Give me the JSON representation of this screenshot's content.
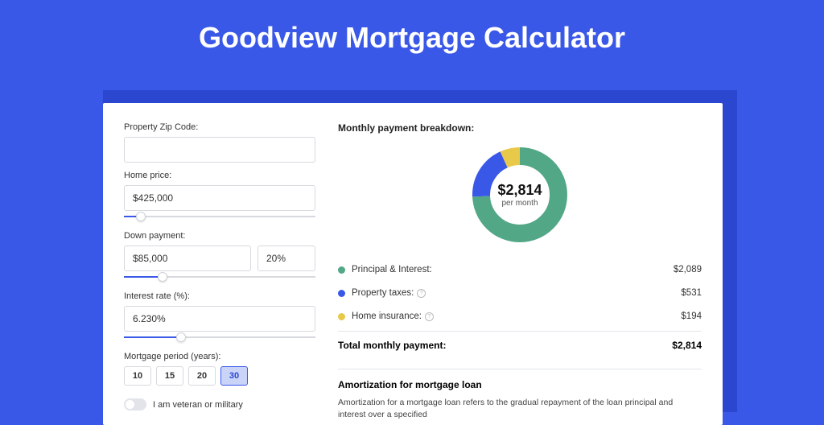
{
  "page": {
    "title": "Goodview Mortgage Calculator"
  },
  "form": {
    "zip_label": "Property Zip Code:",
    "zip_value": "",
    "price_label": "Home price:",
    "price_value": "$425,000",
    "down_label": "Down payment:",
    "down_value": "$85,000",
    "down_pct": "20%",
    "rate_label": "Interest rate (%):",
    "rate_value": "6.230%",
    "period_label": "Mortgage period (years):",
    "period_options": [
      "10",
      "15",
      "20",
      "30"
    ],
    "period_selected": "30",
    "veteran_label": "I am veteran or military"
  },
  "breakdown": {
    "title": "Monthly payment breakdown:",
    "center_amount": "$2,814",
    "center_sub": "per month",
    "items": [
      {
        "label": "Principal & Interest:",
        "value": "$2,089",
        "color": "#52a786",
        "info": false
      },
      {
        "label": "Property taxes:",
        "value": "$531",
        "color": "#3a58e8",
        "info": true
      },
      {
        "label": "Home insurance:",
        "value": "$194",
        "color": "#e8c94a",
        "info": true
      }
    ],
    "total_label": "Total monthly payment:",
    "total_value": "$2,814"
  },
  "amort": {
    "title": "Amortization for mortgage loan",
    "text": "Amortization for a mortgage loan refers to the gradual repayment of the loan principal and interest over a specified"
  },
  "chart_data": {
    "type": "pie",
    "title": "Monthly payment breakdown",
    "series": [
      {
        "name": "Principal & Interest",
        "value": 2089,
        "color": "#52a786"
      },
      {
        "name": "Property taxes",
        "value": 531,
        "color": "#3a58e8"
      },
      {
        "name": "Home insurance",
        "value": 194,
        "color": "#e8c94a"
      }
    ],
    "total": 2814,
    "center_label": "$2,814 per month"
  },
  "sliders": {
    "price_pct": 9,
    "down_pct": 20,
    "rate_pct": 30
  }
}
